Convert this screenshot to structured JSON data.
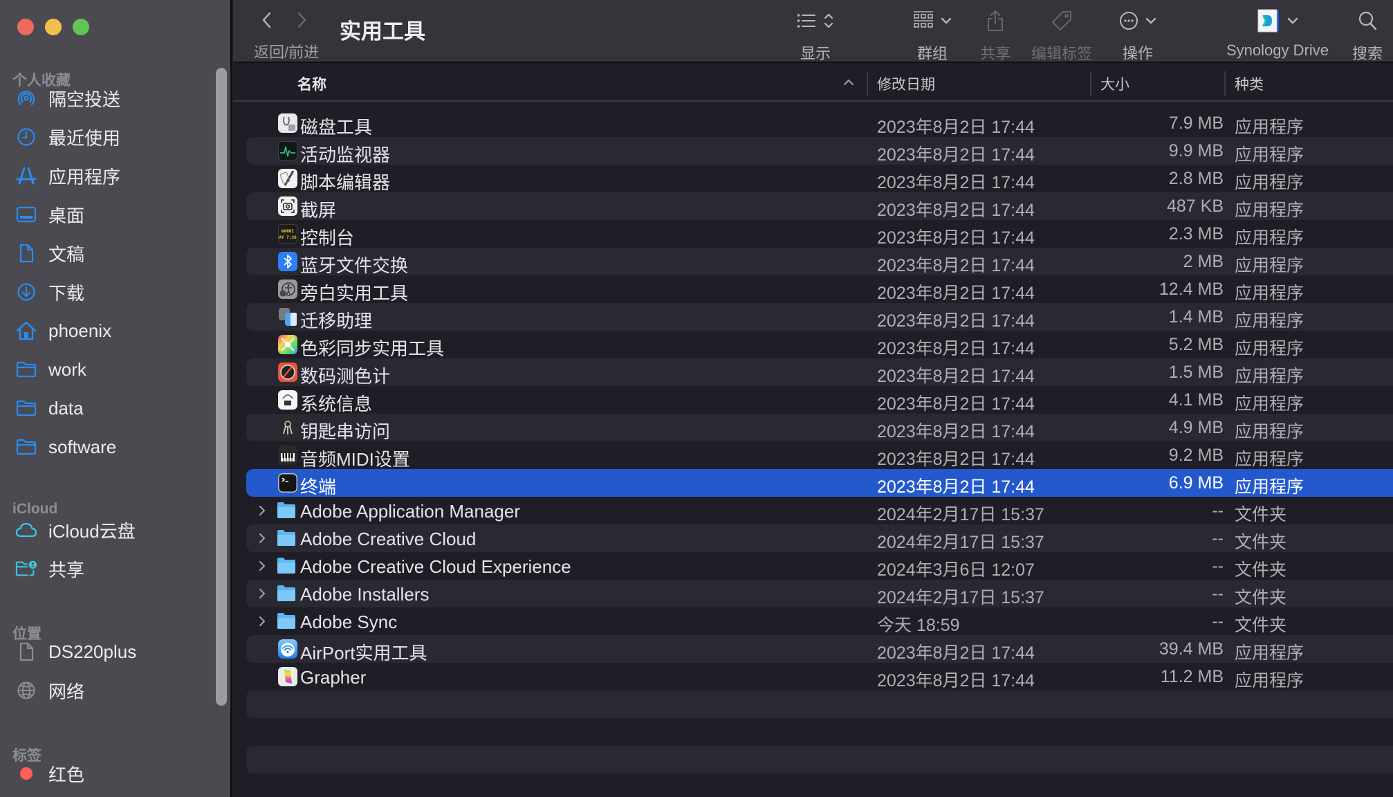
{
  "window": {
    "title": "实用工具",
    "nav_caption": "返回/前进"
  },
  "toolbar": {
    "view_label": "显示",
    "group_label": "群组",
    "share_label": "共享",
    "tags_label": "编辑标签",
    "action_label": "操作",
    "synology_label": "Synology Drive",
    "search_label": "搜索"
  },
  "sidebar": {
    "sections": [
      {
        "title": "个人收藏",
        "items": [
          {
            "label": "隔空投送",
            "icon": "airdrop-icon"
          },
          {
            "label": "最近使用",
            "icon": "clock-icon"
          },
          {
            "label": "应用程序",
            "icon": "apps-icon"
          },
          {
            "label": "桌面",
            "icon": "desktop-icon"
          },
          {
            "label": "文稿",
            "icon": "document-icon"
          },
          {
            "label": "下载",
            "icon": "download-icon"
          },
          {
            "label": "phoenix",
            "icon": "home-icon"
          },
          {
            "label": "work",
            "icon": "folder-icon"
          },
          {
            "label": "data",
            "icon": "folder-icon"
          },
          {
            "label": "software",
            "icon": "folder-icon"
          }
        ]
      },
      {
        "title": "iCloud",
        "items": [
          {
            "label": "iCloud云盘",
            "icon": "cloud-icon"
          },
          {
            "label": "共享",
            "icon": "shared-folder-icon"
          }
        ]
      },
      {
        "title": "位置",
        "items": [
          {
            "label": "DS220plus",
            "icon": "document-icon"
          },
          {
            "label": "网络",
            "icon": "globe-icon"
          }
        ]
      },
      {
        "title": "标签",
        "items": [
          {
            "label": "红色",
            "icon": "red-tag-dot",
            "color": "#ff5f57"
          }
        ]
      }
    ]
  },
  "columns": {
    "name": "名称",
    "date": "修改日期",
    "size": "大小",
    "kind": "种类"
  },
  "files": [
    {
      "name": "磁盘工具",
      "date": "2023年8月2日 17:44",
      "size": "7.9 MB",
      "kind": "应用程序",
      "icon": "disk-utility-icon",
      "folder": false
    },
    {
      "name": "活动监视器",
      "date": "2023年8月2日 17:44",
      "size": "9.9 MB",
      "kind": "应用程序",
      "icon": "activity-monitor-icon",
      "folder": false
    },
    {
      "name": "脚本编辑器",
      "date": "2023年8月2日 17:44",
      "size": "2.8 MB",
      "kind": "应用程序",
      "icon": "script-editor-icon",
      "folder": false
    },
    {
      "name": "截屏",
      "date": "2023年8月2日 17:44",
      "size": "487 KB",
      "kind": "应用程序",
      "icon": "screenshot-icon",
      "folder": false
    },
    {
      "name": "控制台",
      "date": "2023年8月2日 17:44",
      "size": "2.3 MB",
      "kind": "应用程序",
      "icon": "console-icon",
      "folder": false
    },
    {
      "name": "蓝牙文件交换",
      "date": "2023年8月2日 17:44",
      "size": "2 MB",
      "kind": "应用程序",
      "icon": "bluetooth-icon",
      "folder": false
    },
    {
      "name": "旁白实用工具",
      "date": "2023年8月2日 17:44",
      "size": "12.4 MB",
      "kind": "应用程序",
      "icon": "voiceover-icon",
      "folder": false
    },
    {
      "name": "迁移助理",
      "date": "2023年8月2日 17:44",
      "size": "1.4 MB",
      "kind": "应用程序",
      "icon": "migration-assistant-icon",
      "folder": false
    },
    {
      "name": "色彩同步实用工具",
      "date": "2023年8月2日 17:44",
      "size": "5.2 MB",
      "kind": "应用程序",
      "icon": "colorsync-icon",
      "folder": false
    },
    {
      "name": "数码测色计",
      "date": "2023年8月2日 17:44",
      "size": "1.5 MB",
      "kind": "应用程序",
      "icon": "color-meter-icon",
      "folder": false
    },
    {
      "name": "系统信息",
      "date": "2023年8月2日 17:44",
      "size": "4.1 MB",
      "kind": "应用程序",
      "icon": "system-info-icon",
      "folder": false
    },
    {
      "name": "钥匙串访问",
      "date": "2023年8月2日 17:44",
      "size": "4.9 MB",
      "kind": "应用程序",
      "icon": "keychain-icon",
      "folder": false
    },
    {
      "name": "音频MIDI设置",
      "date": "2023年8月2日 17:44",
      "size": "9.2 MB",
      "kind": "应用程序",
      "icon": "midi-icon",
      "folder": false
    },
    {
      "name": "终端",
      "date": "2023年8月2日 17:44",
      "size": "6.9 MB",
      "kind": "应用程序",
      "icon": "terminal-icon",
      "folder": false,
      "selected": true
    },
    {
      "name": "Adobe Application Manager",
      "date": "2024年2月17日 15:37",
      "size": "--",
      "kind": "文件夹",
      "icon": "folder-icon",
      "folder": true
    },
    {
      "name": "Adobe Creative Cloud",
      "date": "2024年2月17日 15:37",
      "size": "--",
      "kind": "文件夹",
      "icon": "folder-icon",
      "folder": true
    },
    {
      "name": "Adobe Creative Cloud Experience",
      "date": "2024年3月6日 12:07",
      "size": "--",
      "kind": "文件夹",
      "icon": "folder-icon",
      "folder": true
    },
    {
      "name": "Adobe Installers",
      "date": "2024年2月17日 15:37",
      "size": "--",
      "kind": "文件夹",
      "icon": "folder-icon",
      "folder": true
    },
    {
      "name": "Adobe Sync",
      "date": "今天 18:59",
      "size": "--",
      "kind": "文件夹",
      "icon": "folder-icon",
      "folder": true
    },
    {
      "name": "AirPort实用工具",
      "date": "2023年8月2日 17:44",
      "size": "39.4 MB",
      "kind": "应用程序",
      "icon": "airport-icon",
      "folder": false
    },
    {
      "name": "Grapher",
      "date": "2023年8月2日 17:44",
      "size": "11.2 MB",
      "kind": "应用程序",
      "icon": "grapher-icon",
      "folder": false
    }
  ],
  "colors": {
    "accent": "#2a8cf0",
    "selection": "#2359cc",
    "icloud": "#3cc8e8"
  }
}
